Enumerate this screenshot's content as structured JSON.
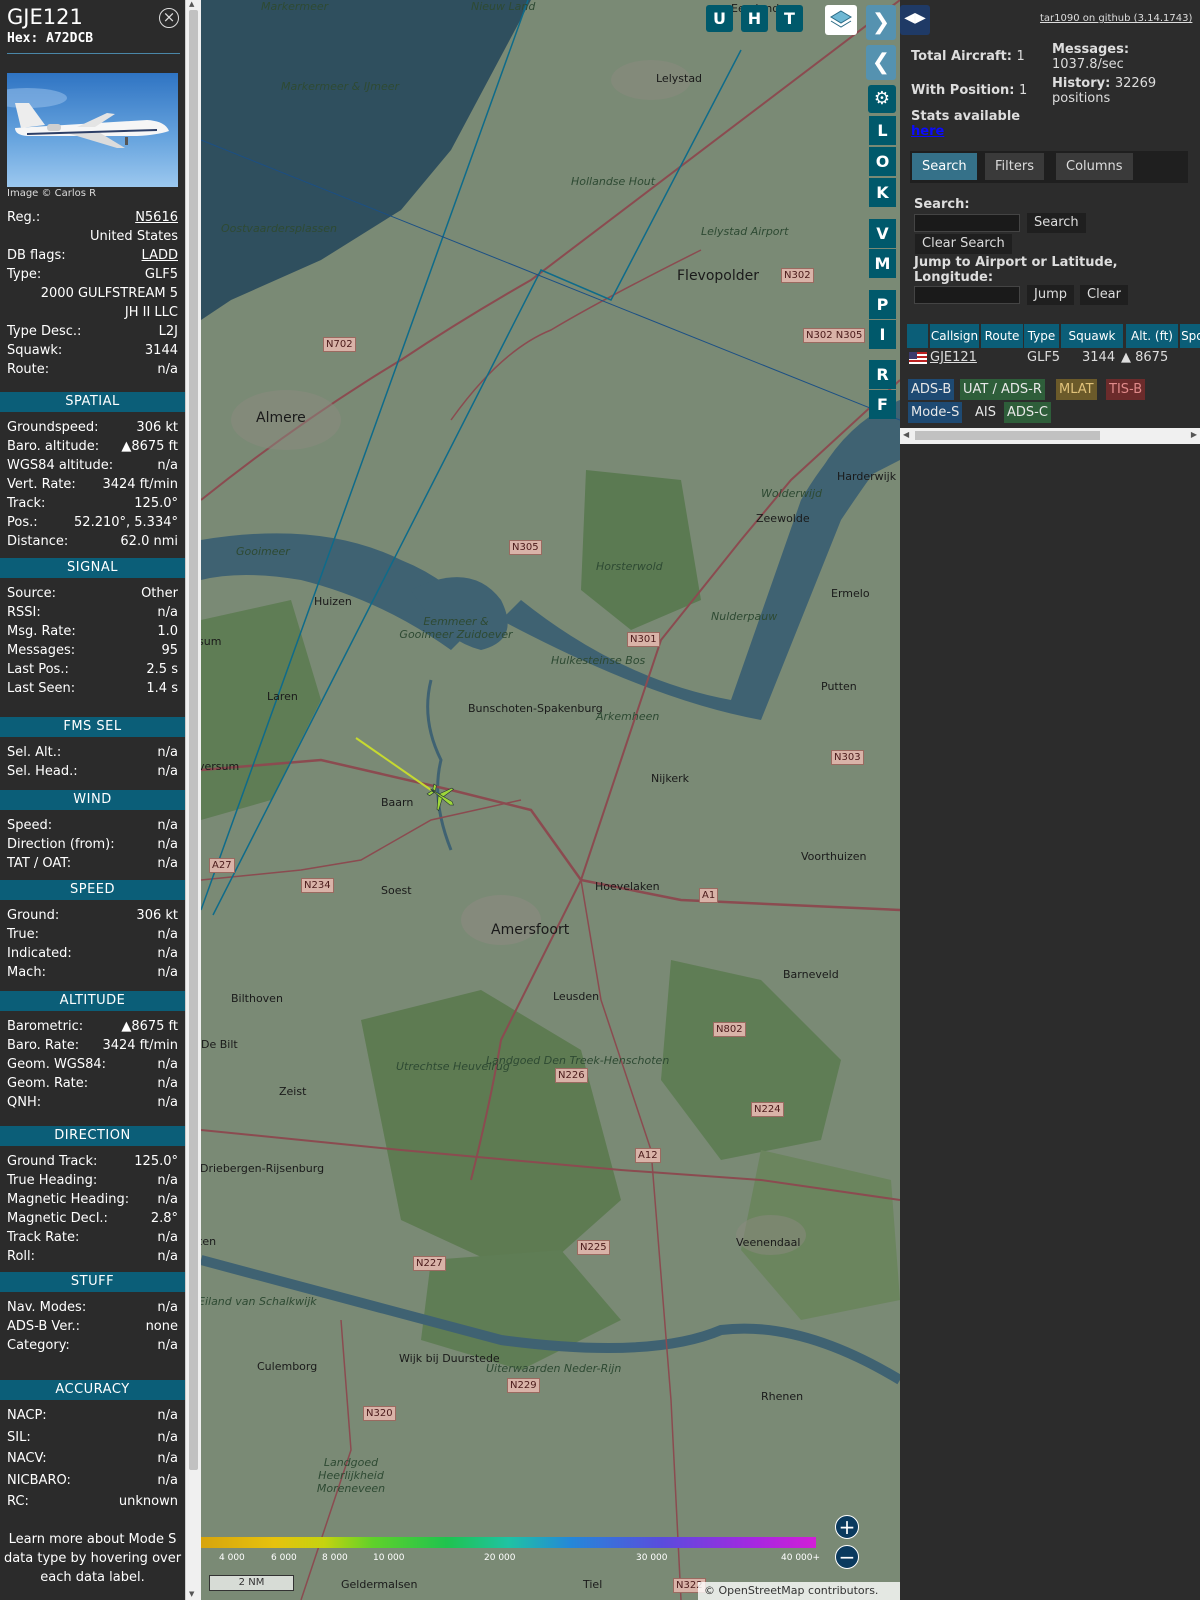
{
  "aircraft": {
    "callsign": "GJE121",
    "hex": "Hex: A72DCB",
    "image_credit": "Image © Carlos R",
    "close_icon": "close-icon",
    "fields": [
      {
        "k": "Reg.:",
        "v": "N5616",
        "link": true
      },
      {
        "k": "",
        "v": "United States"
      },
      {
        "k": "DB flags:",
        "v": "LADD",
        "link": true
      },
      {
        "k": "Type:",
        "v": "GLF5"
      },
      {
        "k": "",
        "v": "2000 GULFSTREAM 5"
      },
      {
        "k": "",
        "v": "JH II LLC"
      },
      {
        "k": "Type Desc.:",
        "v": "L2J"
      },
      {
        "k": "Squawk:",
        "v": "3144"
      },
      {
        "k": "Route:",
        "v": "n/a"
      }
    ]
  },
  "sections": [
    {
      "title": "SPATIAL",
      "rows": [
        [
          "Groundspeed:",
          "306 kt"
        ],
        [
          "Baro. altitude:",
          "▲8675 ft"
        ],
        [
          "WGS84 altitude:",
          "n/a"
        ],
        [
          "Vert. Rate:",
          "3424 ft/min"
        ],
        [
          "Track:",
          "125.0°"
        ],
        [
          "Pos.:",
          "52.210°, 5.334°"
        ],
        [
          "Distance:",
          "62.0 nmi"
        ]
      ]
    },
    {
      "title": "SIGNAL",
      "rows": [
        [
          "Source:",
          "Other"
        ],
        [
          "RSSI:",
          "n/a"
        ],
        [
          "Msg. Rate:",
          "1.0"
        ],
        [
          "Messages:",
          "95"
        ],
        [
          "Last Pos.:",
          "2.5 s"
        ],
        [
          "Last Seen:",
          "1.4 s"
        ]
      ]
    },
    {
      "title": "FMS SEL",
      "rows": [
        [
          "Sel. Alt.:",
          "n/a"
        ],
        [
          "Sel. Head.:",
          "n/a"
        ]
      ]
    },
    {
      "title": "WIND",
      "rows": [
        [
          "Speed:",
          "n/a"
        ],
        [
          "Direction (from):",
          "n/a"
        ],
        [
          "TAT / OAT:",
          "n/a"
        ]
      ]
    },
    {
      "title": "SPEED",
      "rows": [
        [
          "Ground:",
          "306 kt"
        ],
        [
          "True:",
          "n/a"
        ],
        [
          "Indicated:",
          "n/a"
        ],
        [
          "Mach:",
          "n/a"
        ]
      ]
    },
    {
      "title": "ALTITUDE",
      "rows": [
        [
          "Barometric:",
          "▲8675 ft"
        ],
        [
          "Baro. Rate:",
          "3424 ft/min"
        ],
        [
          "Geom. WGS84:",
          "n/a"
        ],
        [
          "Geom. Rate:",
          "n/a"
        ],
        [
          "QNH:",
          "n/a"
        ]
      ]
    },
    {
      "title": "DIRECTION",
      "rows": [
        [
          "Ground Track:",
          "125.0°"
        ],
        [
          "True Heading:",
          "n/a"
        ],
        [
          "Magnetic Heading:",
          "n/a"
        ],
        [
          "Magnetic Decl.:",
          "2.8°"
        ],
        [
          "Track Rate:",
          "n/a"
        ],
        [
          "Roll:",
          "n/a"
        ]
      ]
    },
    {
      "title": "STUFF",
      "rows": [
        [
          "Nav. Modes:",
          "n/a"
        ],
        [
          "ADS-B Ver.:",
          "none"
        ],
        [
          "Category:",
          "n/a"
        ]
      ]
    },
    {
      "title": "ACCURACY",
      "rows": [
        [
          "NACP:",
          "n/a"
        ],
        [
          "SIL:",
          "n/a"
        ],
        [
          "NACV:",
          "n/a"
        ],
        [
          "NICBARO:",
          "n/a"
        ],
        [
          "RC:",
          "unknown"
        ]
      ]
    }
  ],
  "learn_more": "Learn more about Mode S data type by hovering over each data label.",
  "map": {
    "top_buttons": [
      "U",
      "H",
      "T"
    ],
    "side_buttons": [
      "L",
      "O",
      "K",
      "V",
      "M",
      "P",
      "I",
      "R",
      "F"
    ],
    "place_labels": [
      "Markermeer & IJmeer",
      "Lelystad",
      "Almere",
      "Flevopolder",
      "Harderwijk",
      "Zeewolde",
      "Huizen",
      "Bunschoten-Spakenburg",
      "Nijkerk",
      "Baarn",
      "Soest",
      "Amersfoort",
      "Hoevelaken",
      "Barneveld",
      "Leusden",
      "Bilthoven",
      "Zeist",
      "De Bilt",
      "Utrechtse Heuvelrug",
      "Driebergen-Rijsenburg",
      "Veenendaal",
      "Rhenen",
      "Wijk bij Duurstede",
      "Culemborg",
      "Putten",
      "Ermelo",
      "Voorthuizen",
      "Laren",
      "Eemmeer & Gooimeer Zuidoever",
      "Horsterwold",
      "Hollandse Hout",
      "Lelystad Airport",
      "Oostvaardersplassen",
      "Nieuw Land",
      "Markermeer",
      "Geldermalsen",
      "Tiel",
      "Eiland van Schalkwijk",
      "Landgoed Den Treek-Henschoten",
      "Uiterwaarden Neder-Rijn",
      "Hulkesteinse Bos",
      "Arkemheen",
      "Landgoed Heerlijkheid Moreneveen",
      "Nulderpauw",
      "Wolderwijd",
      "Gooimeer",
      "Eemland",
      "versum",
      "sum",
      "ten"
    ],
    "road_labels": [
      "N702",
      "N302",
      "N302 N305",
      "N305",
      "N301",
      "N303",
      "A27",
      "N234",
      "A1",
      "N802",
      "N226",
      "N224",
      "A12",
      "N225",
      "N227",
      "N229",
      "N320",
      "N322"
    ],
    "alt_scale": [
      "4 000",
      "6 000",
      "8 000",
      "10 000",
      "20 000",
      "30 000",
      "40 000+"
    ],
    "scale_bar": "2 NM",
    "attribution_prefix": "© ",
    "attribution_link": "OpenStreetMap",
    "attribution_suffix": " contributors.",
    "zoom_in": "+",
    "zoom_out": "−"
  },
  "stats": {
    "version": "tar1090 on github (3.14.1743)",
    "total_label": "Total Aircraft:",
    "total_value": "1",
    "pos_label": "With Position:",
    "pos_value": "1",
    "msgs_label": "Messages:",
    "msgs_value": "1037.8/sec",
    "hist_label": "History:",
    "hist_value": "32269 positions",
    "stats_text": "Stats available",
    "stats_link": "here"
  },
  "tabs": [
    "Search",
    "Filters",
    "Columns"
  ],
  "search": {
    "label": "Search:",
    "button": "Search",
    "clear": "Clear Search",
    "jump_label": "Jump to Airport or Latitude, Longitude:",
    "jump": "Jump",
    "jump_clear": "Clear"
  },
  "table": {
    "headers": [
      "",
      "Callsign",
      "Route",
      "Type",
      "Squawk",
      "Alt. (ft)",
      "Spd"
    ],
    "rows": [
      {
        "flag": "us-flag-icon",
        "callsign": "GJE121",
        "route": "",
        "type": "GLF5",
        "squawk": "3144",
        "alt": "▲ 8675",
        "spd": ""
      }
    ]
  },
  "sources": [
    {
      "label": "ADS-B",
      "color": "#1e4a73"
    },
    {
      "label": "UAT / ADS-R",
      "color": "#2e5e3a"
    },
    {
      "label": "MLAT",
      "color": "#6b5a2a"
    },
    {
      "label": "TIS-B",
      "color": "#6b2b2b"
    },
    {
      "label": "Mode-S",
      "color": "#1e4a73"
    },
    {
      "label": "AIS",
      "color": "#2c2c2c"
    },
    {
      "label": "ADS-C",
      "color": "#2e5e3a"
    }
  ]
}
